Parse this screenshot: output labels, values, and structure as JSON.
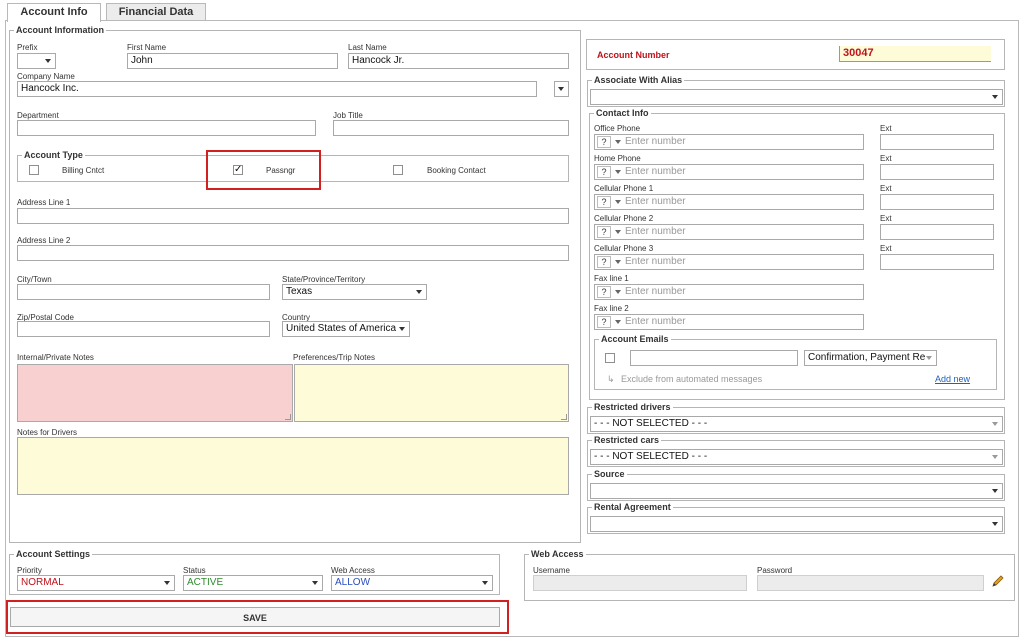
{
  "tabs": [
    {
      "label": "Account Info"
    },
    {
      "label": "Financial Data"
    }
  ],
  "account_information": {
    "legend": "Account Information",
    "prefix": {
      "label": "Prefix",
      "value": ""
    },
    "first_name": {
      "label": "First Name",
      "value": "John"
    },
    "last_name": {
      "label": "Last Name",
      "value": "Hancock Jr."
    },
    "company_name": {
      "label": "Company Name",
      "value": "Hancock Inc."
    },
    "department": {
      "label": "Department",
      "value": ""
    },
    "job_title": {
      "label": "Job Title",
      "value": ""
    },
    "account_type": {
      "legend": "Account Type",
      "options": [
        {
          "label": "Billing Cntct",
          "checked": false
        },
        {
          "label": "Passngr",
          "checked": true
        },
        {
          "label": "Booking Contact",
          "checked": false
        }
      ]
    },
    "address1": {
      "label": "Address Line 1",
      "value": ""
    },
    "address2": {
      "label": "Address Line 2",
      "value": ""
    },
    "city": {
      "label": "City/Town",
      "value": ""
    },
    "state": {
      "label": "State/Province/Territory",
      "value": "Texas"
    },
    "zip": {
      "label": "Zip/Postal Code",
      "value": ""
    },
    "country": {
      "label": "Country",
      "value": "United States of America"
    },
    "internal_notes": {
      "label": "Internal/Private Notes",
      "bg": "#f9d0d0"
    },
    "preferences_notes": {
      "label": "Preferences/Trip Notes",
      "bg": "#fdfbd8"
    },
    "driver_notes": {
      "label": "Notes for Drivers",
      "bg": "#fdfbd8"
    }
  },
  "account_number": {
    "label": "Account Number",
    "value": "30047",
    "label_color": "#c0121b",
    "field_bg": "#fdfbd8"
  },
  "associate_alias": {
    "legend": "Associate With Alias",
    "value": ""
  },
  "contact_info": {
    "legend": "Contact Info",
    "phones": [
      {
        "label": "Office Phone",
        "prefix": "?",
        "placeholder": "Enter number",
        "ext_label": "Ext"
      },
      {
        "label": "Home Phone",
        "prefix": "?",
        "placeholder": "Enter number",
        "ext_label": "Ext"
      },
      {
        "label": "Cellular Phone 1",
        "prefix": "?",
        "placeholder": "Enter number",
        "ext_label": "Ext"
      },
      {
        "label": "Cellular Phone 2",
        "prefix": "?",
        "placeholder": "Enter number",
        "ext_label": "Ext"
      },
      {
        "label": "Cellular Phone 3",
        "prefix": "?",
        "placeholder": "Enter number",
        "ext_label": "Ext"
      },
      {
        "label": "Fax line 1",
        "prefix": "?",
        "placeholder": "Enter number"
      },
      {
        "label": "Fax line 2",
        "prefix": "?",
        "placeholder": "Enter number"
      }
    ],
    "emails": {
      "legend": "Account Emails",
      "type_value": "Confirmation, Payment Re",
      "exclude_label": "Exclude from automated messages",
      "add_new": "Add new"
    }
  },
  "restricted_drivers": {
    "legend": "Restricted drivers",
    "value": "- - - NOT SELECTED - - -"
  },
  "restricted_cars": {
    "legend": "Restricted cars",
    "value": "- - - NOT SELECTED - - -"
  },
  "source": {
    "legend": "Source",
    "value": ""
  },
  "rental_agreement": {
    "legend": "Rental Agreement",
    "value": ""
  },
  "account_settings": {
    "legend": "Account Settings",
    "priority": {
      "label": "Priority",
      "value": "NORMAL",
      "color": "#c0121b"
    },
    "status": {
      "label": "Status",
      "value": "ACTIVE",
      "color": "#2e8b2e"
    },
    "web_access": {
      "label": "Web Access",
      "value": "ALLOW",
      "color": "#2b4fbf"
    }
  },
  "web_access": {
    "legend": "Web Access",
    "username": {
      "label": "Username",
      "value": ""
    },
    "password": {
      "label": "Password",
      "value": ""
    }
  },
  "save_label": "SAVE",
  "highlight_color": "#d02020"
}
